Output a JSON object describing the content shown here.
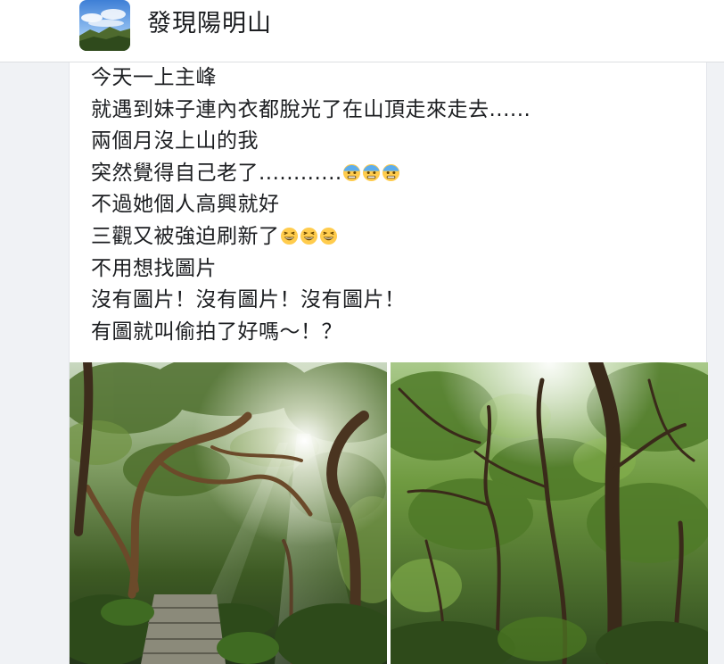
{
  "header": {
    "page_name": "發現陽明山"
  },
  "post": {
    "lines": [
      "今天一上主峰",
      "就遇到妹子連內衣都脫光了在山頂走來走去......",
      "兩個月沒上山的我",
      "突然覺得自己老了............",
      "不過她個人高興就好",
      "三觀又被強迫刷新了",
      "不用想找圖片",
      "沒有圖片！沒有圖片！沒有圖片！",
      "有圖就叫偷拍了好嗎～！？"
    ],
    "emojis": {
      "line4": [
        "anxious-sweat-emoji",
        "anxious-sweat-emoji",
        "anxious-sweat-emoji"
      ],
      "line6": [
        "laughing-emoji",
        "laughing-emoji",
        "laughing-emoji"
      ]
    }
  },
  "photos": [
    {
      "name": "forest-stone-path-sunrays-photo"
    },
    {
      "name": "forest-canopy-sunlight-photo"
    }
  ],
  "colors": {
    "background": "#f0f2f5",
    "card": "#ffffff",
    "text": "#1c1e21",
    "emoji_yellow": "#ffcc4d",
    "emoji_blue": "#5dadec"
  }
}
